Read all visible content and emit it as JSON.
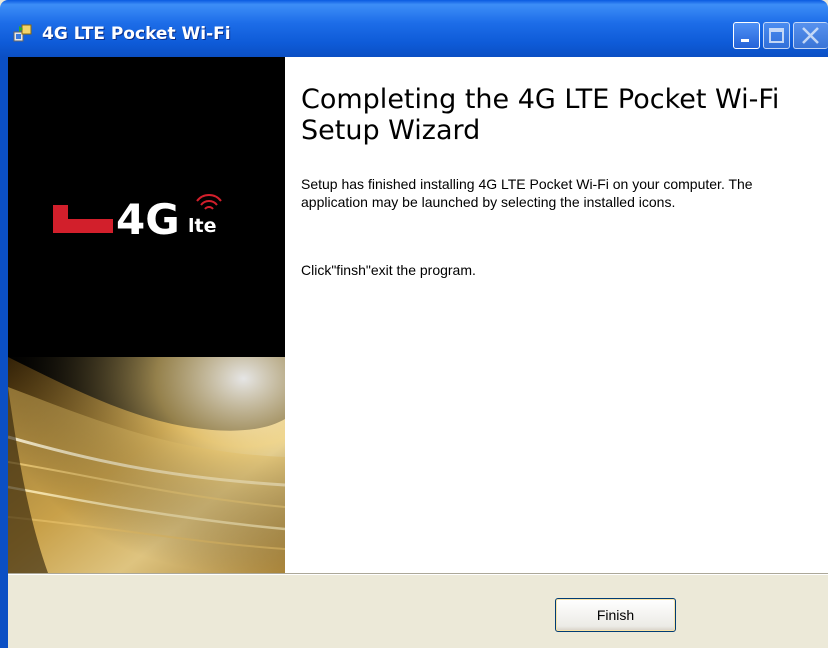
{
  "window": {
    "title": "4G LTE Pocket Wi-Fi"
  },
  "banner": {
    "logo_main": "4G",
    "logo_sub": "lte"
  },
  "content": {
    "heading": "Completing the 4G LTE Pocket Wi-Fi Setup Wizard",
    "paragraph1": "Setup has finished installing 4G LTE Pocket Wi-Fi on your computer. The application may be launched by selecting the installed icons.",
    "paragraph2": "Click\"finsh\"exit the program."
  },
  "footer": {
    "finish_label": "Finish"
  },
  "icons": {
    "app": "installer-icon",
    "minimize": "minimize-icon",
    "maximize": "maximize-icon",
    "close": "close-icon"
  },
  "colors": {
    "titlebar": "#0b4fc4",
    "logo_red": "#d21f2b",
    "banner_bg": "#000000",
    "dialog_bg": "#ece9d8"
  }
}
